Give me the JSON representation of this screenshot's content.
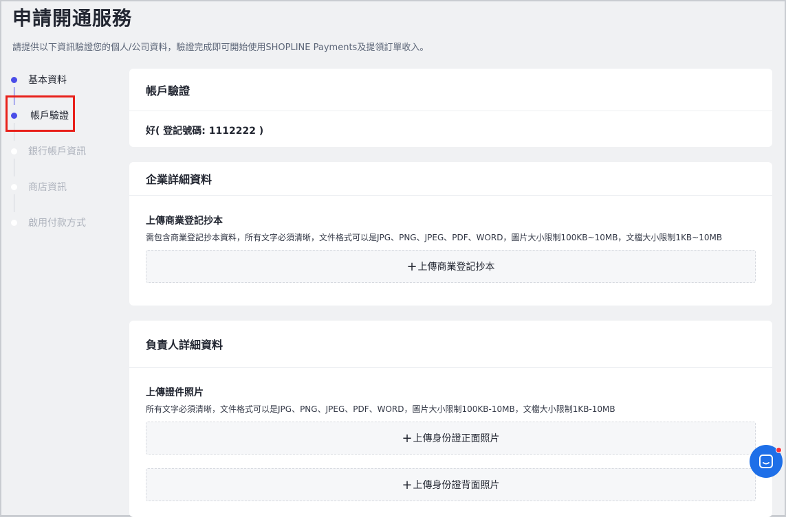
{
  "page": {
    "title": "申請開通服務",
    "subtitle": "請提供以下資訊驗證您的個人/公司資料，驗證完成即可開始使用SHOPLINE Payments及提領訂單收入。"
  },
  "steps": [
    {
      "label": "基本資料",
      "state": "done"
    },
    {
      "label": "帳戶驗證",
      "state": "active"
    },
    {
      "label": "銀行帳戶資訊",
      "state": "pending"
    },
    {
      "label": "商店資訊",
      "state": "pending"
    },
    {
      "label": "啟用付款方式",
      "state": "pending"
    }
  ],
  "account_card": {
    "title": "帳戶驗證",
    "value": "好( 登記號碼: 1112222 )"
  },
  "company_card": {
    "title": "企業詳細資料",
    "field_title": "上傳商業登記抄本",
    "hint": "需包含商業登記抄本資料，所有文字必須清晰，文件格式可以是JPG、PNG、JPEG、PDF、WORD，圖片大小限制100KB~10MB，文檔大小限制1KB~10MB",
    "upload_label": "上傳商業登記抄本"
  },
  "owner_card": {
    "title": "負責人詳細資料",
    "field_title": "上傳證件照片",
    "hint": "所有文字必須清晰，文件格式可以是JPG、PNG、JPEG、PDF、WORD，圖片大小限制100KB-10MB，文檔大小限制1KB-10MB",
    "upload_front_label": "上傳身份證正面照片",
    "upload_back_label": "上傳身份證背面照片"
  },
  "icons": {
    "plus": "plus-icon",
    "chat": "chat-bubble-icon"
  },
  "colors": {
    "accent": "#4a4de8",
    "highlight": "#e8201a",
    "chat": "#1e6fe8"
  }
}
